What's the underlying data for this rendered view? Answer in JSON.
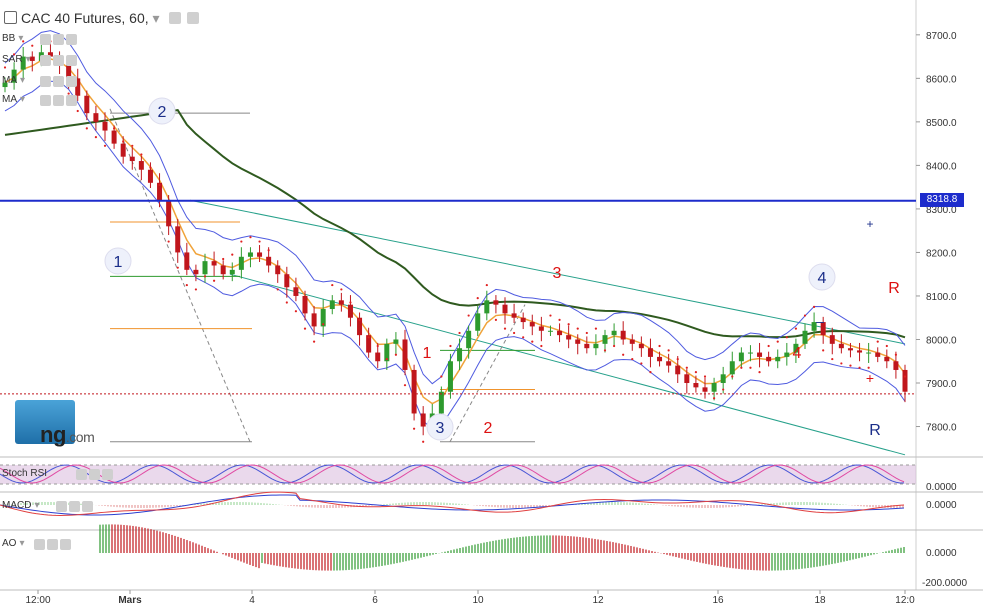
{
  "header": {
    "title": "CAC 40 Futures, 60,",
    "chevron": "▾"
  },
  "indicators": {
    "bb": "BB",
    "sar": "SAR",
    "ma1": "MA",
    "ma2": "MA",
    "stoch_rsi": "Stoch RSI",
    "macd": "MACD",
    "ao": "AO"
  },
  "logo": {
    "text": "ng",
    "suffix": ".com"
  },
  "price_tag": "8318.8",
  "colors": {
    "bull": "#2e9a2e",
    "bear": "#c0161c",
    "resistance": "#1d2ccc",
    "ma_long": "#2f5a1f",
    "ma_short": "#f0a33a",
    "bb": "#4f5be0",
    "sar": "#e02020",
    "channel": "#27a18b",
    "stoch_band": "#d8b9dc"
  },
  "chart_data": [
    {
      "type": "candlestick",
      "title": "CAC 40 Futures, 60,",
      "y_ticks": [
        7800.0,
        7900.0,
        8000.0,
        8100.0,
        8200.0,
        8300.0,
        8400.0,
        8500.0,
        8600.0,
        8700.0
      ],
      "y_tick_labels": [
        "7800.0",
        "7900.0",
        "8000.0",
        "8100.0",
        "8200.0",
        "8300.0",
        "8400.0",
        "8500.0",
        "8600.0",
        "8700.0"
      ],
      "ylim": [
        7730,
        8780
      ],
      "x_tick_labels": [
        "12:00",
        "Mars",
        "4",
        "6",
        "10",
        "12",
        "16",
        "18",
        "12:0"
      ],
      "horizontal_line": 8318.8,
      "current_line": 7875,
      "close_series": [
        8590,
        8620,
        8650,
        8640,
        8660,
        8650,
        8630,
        8600,
        8560,
        8520,
        8500,
        8480,
        8450,
        8420,
        8410,
        8390,
        8360,
        8320,
        8260,
        8200,
        8160,
        8150,
        8180,
        8170,
        8150,
        8160,
        8190,
        8200,
        8190,
        8170,
        8150,
        8120,
        8100,
        8060,
        8030,
        8070,
        8090,
        8080,
        8050,
        8010,
        7970,
        7950,
        7990,
        8000,
        7930,
        7830,
        7800,
        7830,
        7880,
        7950,
        7980,
        8020,
        8060,
        8090,
        8080,
        8060,
        8050,
        8040,
        8030,
        8020,
        8020,
        8010,
        8000,
        7990,
        7980,
        7990,
        8010,
        8020,
        8000,
        7990,
        7980,
        7960,
        7950,
        7940,
        7920,
        7900,
        7890,
        7880,
        7900,
        7920,
        7950,
        7970,
        7970,
        7960,
        7950,
        7960,
        7970,
        7990,
        8020,
        8040,
        8010,
        7990,
        7980,
        7975,
        7970,
        7970,
        7960,
        7950,
        7930,
        7880
      ],
      "wave_labels": [
        "1",
        "2",
        "3",
        "1",
        "2",
        "3",
        "4",
        "4",
        "R",
        "R",
        "+",
        "+",
        "–"
      ]
    },
    {
      "type": "line",
      "title": "Stoch RSI",
      "y_tick_labels": [
        "0.0000"
      ]
    },
    {
      "type": "line",
      "title": "MACD",
      "y_tick_labels": [
        "0.0000"
      ]
    },
    {
      "type": "bar",
      "title": "AO",
      "y_tick_labels": [
        "0.0000",
        "-200.0000"
      ]
    }
  ]
}
